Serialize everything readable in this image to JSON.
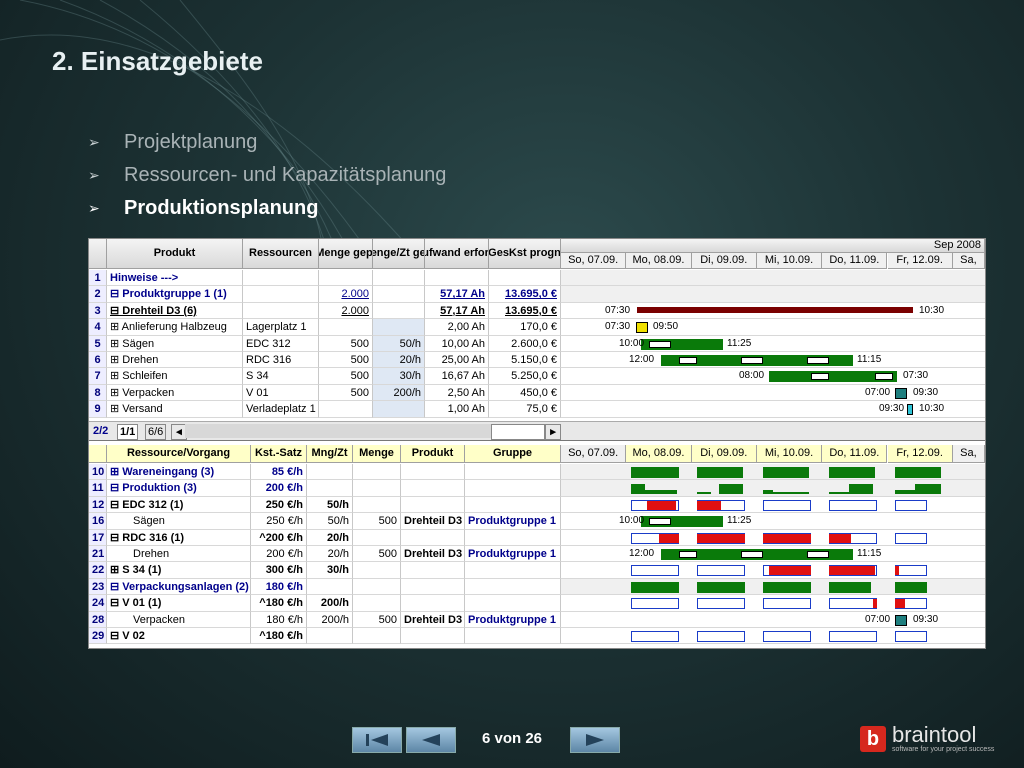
{
  "slide_title": "2. Einsatzgebiete",
  "bullets": [
    "Projektplanung",
    "Ressourcen- und Kapazitätsplanung",
    "Produktionsplanung"
  ],
  "top_table": {
    "headers": [
      "Produkt",
      "Ressourcen",
      "Menge gepl",
      "Menge/Zt gepl",
      "Aufwand erford.",
      "GesKst progn"
    ],
    "month_label": "Sep 2008",
    "dates": [
      "So, 07.09.",
      "Mo, 08.09.",
      "Di, 09.09.",
      "Mi, 10.09.",
      "Do, 11.09.",
      "Fr, 12.09.",
      "Sa,"
    ],
    "rows": [
      {
        "n": "1",
        "produkt": "Hinweise --->",
        "res": "",
        "menge": "",
        "mzt": "",
        "aufwand": "",
        "kst": ""
      },
      {
        "n": "2",
        "produkt": "⊟ Produktgruppe 1 (1)",
        "res": "",
        "menge": "2.000",
        "mzt": "",
        "aufwand": "57,17 Ah",
        "kst": "13.695,0 €"
      },
      {
        "n": "3",
        "produkt": "⊟ Drehteil D3 (6)",
        "res": "",
        "menge": "2.000",
        "mzt": "",
        "aufwand": "57,17 Ah",
        "kst": "13.695,0 €"
      },
      {
        "n": "4",
        "produkt": "⊞ Anlieferung Halbzeug",
        "res": "Lagerplatz 1",
        "menge": "",
        "mzt": "",
        "aufwand": "2,00 Ah",
        "kst": "170,0 €"
      },
      {
        "n": "5",
        "produkt": "⊞ Sägen",
        "res": "EDC 312",
        "menge": "500",
        "mzt": "50/h",
        "aufwand": "10,00 Ah",
        "kst": "2.600,0 €"
      },
      {
        "n": "6",
        "produkt": "⊞ Drehen",
        "res": "RDC 316",
        "menge": "500",
        "mzt": "20/h",
        "aufwand": "25,00 Ah",
        "kst": "5.150,0 €"
      },
      {
        "n": "7",
        "produkt": "⊞ Schleifen",
        "res": "S 34",
        "menge": "500",
        "mzt": "30/h",
        "aufwand": "16,67 Ah",
        "kst": "5.250,0 €"
      },
      {
        "n": "8",
        "produkt": "⊞ Verpacken",
        "res": "V 01",
        "menge": "500",
        "mzt": "200/h",
        "aufwand": "2,50 Ah",
        "kst": "450,0 €"
      },
      {
        "n": "9",
        "produkt": "⊞ Versand",
        "res": "Verladeplatz 1",
        "menge": "",
        "mzt": "",
        "aufwand": "1,00 Ah",
        "kst": "75,0 €"
      }
    ],
    "gantt_labels": {
      "r3_start": "07:30",
      "r3_end": "10:30",
      "r4_start": "07:30",
      "r4_end": "09:50",
      "r5_start": "10:00",
      "r5_end": "11:25",
      "r6_start": "12:00",
      "r6_end": "11:15",
      "r7_start": "08:00",
      "r7_end": "07:30",
      "r8_start": "07:00",
      "r8_end": "09:30",
      "r9_start": "09:30",
      "r9_end": "10:30"
    }
  },
  "tabs": {
    "t1": "2/2",
    "t2": "1/1",
    "t3": "6/6",
    "left": "◂",
    "right": "▸"
  },
  "bottom_table": {
    "headers": [
      "Ressource/Vorgang",
      "Kst.-Satz",
      "Mng/Zt",
      "Menge",
      "Produkt",
      "Gruppe"
    ],
    "dates": [
      "So, 07.09.",
      "Mo, 08.09.",
      "Di, 09.09.",
      "Mi, 10.09.",
      "Do, 11.09.",
      "Fr, 12.09.",
      "Sa,"
    ],
    "rows": [
      {
        "n": "10",
        "name": "⊞ Wareneingang (3)",
        "kst": "85 €/h",
        "mzt": "",
        "menge": "",
        "prod": "",
        "grp": ""
      },
      {
        "n": "11",
        "name": "⊟ Produktion (3)",
        "kst": "200 €/h",
        "mzt": "",
        "menge": "",
        "prod": "",
        "grp": ""
      },
      {
        "n": "12",
        "name": "⊟ EDC 312 (1)",
        "kst": "250 €/h",
        "mzt": "50/h",
        "menge": "",
        "prod": "",
        "grp": ""
      },
      {
        "n": "16",
        "name": "Sägen",
        "kst": "250 €/h",
        "mzt": "50/h",
        "menge": "500",
        "prod": "Drehteil D3",
        "grp": "Produktgruppe 1"
      },
      {
        "n": "17",
        "name": "⊟ RDC 316 (1)",
        "kst": "^200 €/h",
        "mzt": "20/h",
        "menge": "",
        "prod": "",
        "grp": ""
      },
      {
        "n": "21",
        "name": "Drehen",
        "kst": "200 €/h",
        "mzt": "20/h",
        "menge": "500",
        "prod": "Drehteil D3",
        "grp": "Produktgruppe 1"
      },
      {
        "n": "22",
        "name": "⊞ S 34 (1)",
        "kst": "300 €/h",
        "mzt": "30/h",
        "menge": "",
        "prod": "",
        "grp": ""
      },
      {
        "n": "23",
        "name": "⊟ Verpackungsanlagen (2)",
        "kst": "180 €/h",
        "mzt": "",
        "menge": "",
        "prod": "",
        "grp": ""
      },
      {
        "n": "24",
        "name": "⊟ V 01 (1)",
        "kst": "^180 €/h",
        "mzt": "200/h",
        "menge": "",
        "prod": "",
        "grp": ""
      },
      {
        "n": "28",
        "name": "Verpacken",
        "kst": "180 €/h",
        "mzt": "200/h",
        "menge": "500",
        "prod": "Drehteil D3",
        "grp": "Produktgruppe 1"
      },
      {
        "n": "29",
        "name": "⊟ V 02",
        "kst": "^180 €/h",
        "mzt": "",
        "menge": "",
        "prod": "",
        "grp": ""
      }
    ],
    "gantt_labels": {
      "r16_start": "10:00",
      "r16_end": "11:25",
      "r21_start": "12:00",
      "r21_end": "11:15",
      "r28_start": "07:00",
      "r28_end": "09:30"
    }
  },
  "pager": "6 von 26",
  "logo": {
    "mark": "b",
    "name": "braintool",
    "tagline": "software for your project success"
  },
  "colors": {
    "green": "#0a7a0a",
    "red": "#e01010",
    "accent_blue": "#00008b"
  }
}
